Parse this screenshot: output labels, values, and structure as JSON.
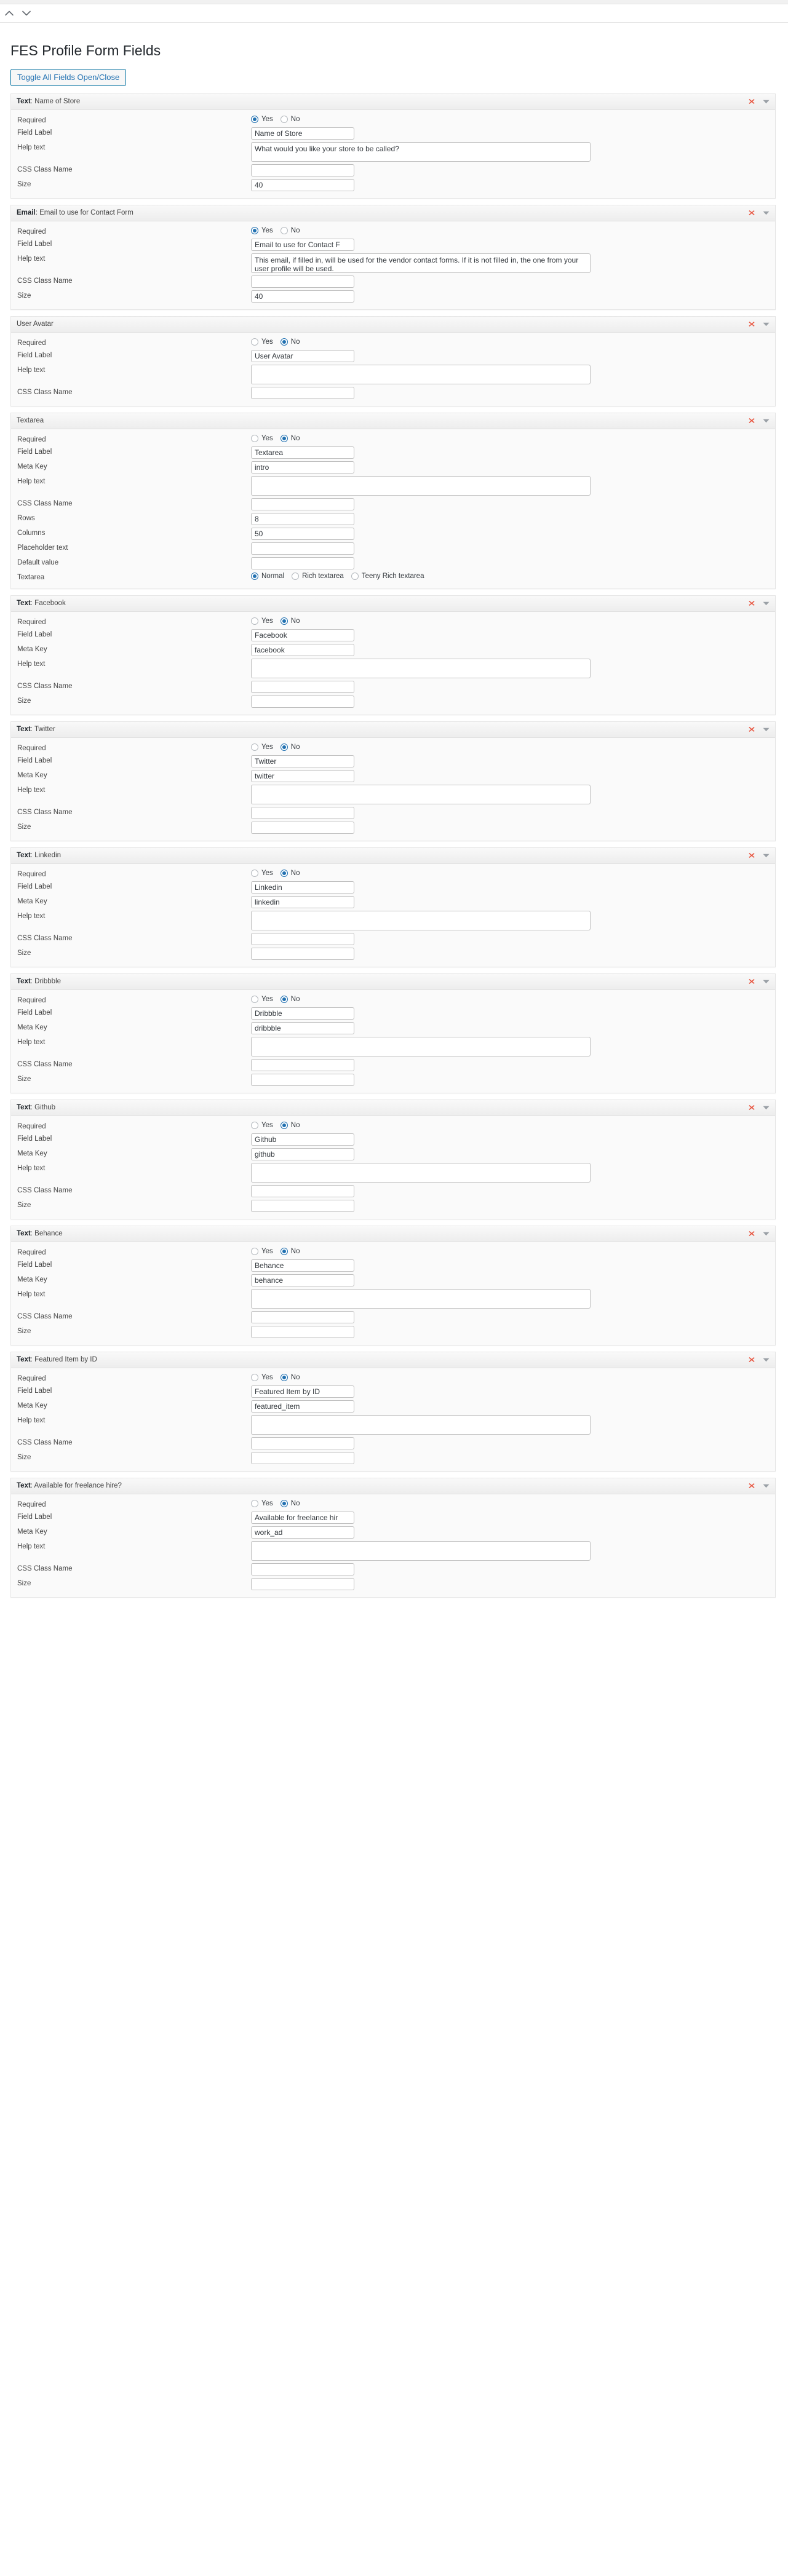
{
  "page": {
    "title": "FES Profile Form Fields",
    "toggle_all_label": "Toggle All Fields Open/Close"
  },
  "screen_meta": {
    "collapse_up_icon": "chevron-up-icon",
    "collapse_down_icon": "chevron-down-icon"
  },
  "panel_icons": {
    "remove": "remove-field-icon",
    "toggle": "toggle-panel-icon"
  },
  "labels": {
    "required": "Required",
    "field_label": "Field Label",
    "meta_key": "Meta Key",
    "help_text": "Help text",
    "css_class_name": "CSS Class Name",
    "size": "Size",
    "rows": "Rows",
    "columns": "Columns",
    "placeholder_text": "Placeholder text",
    "default_value": "Default value",
    "textarea": "Textarea"
  },
  "options": {
    "yes": "Yes",
    "no": "No",
    "normal": "Normal",
    "rich_textarea": "Rich textarea",
    "teeny_rich_textarea": "Teeny Rich textarea"
  },
  "fields": [
    {
      "type_label": "Text",
      "title_text": "Name of Store",
      "required": "yes",
      "field_label": "Name of Store",
      "help_text": "What would you like your store to be called?",
      "css_class": "",
      "size": "40",
      "rows": [
        {
          "kind": "radio-yesno",
          "label_key": "required",
          "selected": "yes"
        },
        {
          "kind": "text",
          "label_key": "field_label",
          "value": "Name of Store"
        },
        {
          "kind": "textarea",
          "label_key": "help_text",
          "value": "What would you like your store to be called?"
        },
        {
          "kind": "text",
          "label_key": "css_class_name",
          "value": ""
        },
        {
          "kind": "text",
          "label_key": "size",
          "value": "40"
        }
      ]
    },
    {
      "type_label": "Email",
      "title_text": "Email to use for Contact Form",
      "rows": [
        {
          "kind": "radio-yesno",
          "label_key": "required",
          "selected": "yes"
        },
        {
          "kind": "text",
          "label_key": "field_label",
          "value": "Email to use for Contact F"
        },
        {
          "kind": "textarea",
          "label_key": "help_text",
          "value": "This email, if filled in, will be used for the vendor contact forms. If it is not filled in, the one from your user profile will be used."
        },
        {
          "kind": "text",
          "label_key": "css_class_name",
          "value": ""
        },
        {
          "kind": "text",
          "label_key": "size",
          "value": "40"
        }
      ]
    },
    {
      "type_label": "",
      "title_text": "User Avatar",
      "rows": [
        {
          "kind": "radio-yesno",
          "label_key": "required",
          "selected": "no"
        },
        {
          "kind": "text",
          "label_key": "field_label",
          "value": "User Avatar"
        },
        {
          "kind": "textarea",
          "label_key": "help_text",
          "value": ""
        },
        {
          "kind": "text",
          "label_key": "css_class_name",
          "value": ""
        }
      ]
    },
    {
      "type_label": "",
      "title_text": "Textarea",
      "rows": [
        {
          "kind": "radio-yesno",
          "label_key": "required",
          "selected": "no"
        },
        {
          "kind": "text",
          "label_key": "field_label",
          "value": "Textarea"
        },
        {
          "kind": "text",
          "label_key": "meta_key",
          "value": "intro"
        },
        {
          "kind": "textarea",
          "label_key": "help_text",
          "value": ""
        },
        {
          "kind": "text",
          "label_key": "css_class_name",
          "value": ""
        },
        {
          "kind": "text",
          "label_key": "rows",
          "value": "8"
        },
        {
          "kind": "text",
          "label_key": "columns",
          "value": "50"
        },
        {
          "kind": "text",
          "label_key": "placeholder_text",
          "value": ""
        },
        {
          "kind": "text",
          "label_key": "default_value",
          "value": ""
        },
        {
          "kind": "radio-textarea",
          "label_key": "textarea",
          "selected": "normal"
        }
      ]
    },
    {
      "type_label": "Text",
      "title_text": "Facebook",
      "rows": [
        {
          "kind": "radio-yesno",
          "label_key": "required",
          "selected": "no"
        },
        {
          "kind": "text",
          "label_key": "field_label",
          "value": "Facebook"
        },
        {
          "kind": "text",
          "label_key": "meta_key",
          "value": "facebook"
        },
        {
          "kind": "textarea",
          "label_key": "help_text",
          "value": ""
        },
        {
          "kind": "text",
          "label_key": "css_class_name",
          "value": ""
        },
        {
          "kind": "text",
          "label_key": "size",
          "value": ""
        }
      ]
    },
    {
      "type_label": "Text",
      "title_text": "Twitter",
      "rows": [
        {
          "kind": "radio-yesno",
          "label_key": "required",
          "selected": "no"
        },
        {
          "kind": "text",
          "label_key": "field_label",
          "value": "Twitter"
        },
        {
          "kind": "text",
          "label_key": "meta_key",
          "value": "twitter"
        },
        {
          "kind": "textarea",
          "label_key": "help_text",
          "value": ""
        },
        {
          "kind": "text",
          "label_key": "css_class_name",
          "value": ""
        },
        {
          "kind": "text",
          "label_key": "size",
          "value": ""
        }
      ]
    },
    {
      "type_label": "Text",
      "title_text": "Linkedin",
      "rows": [
        {
          "kind": "radio-yesno",
          "label_key": "required",
          "selected": "no"
        },
        {
          "kind": "text",
          "label_key": "field_label",
          "value": "Linkedin"
        },
        {
          "kind": "text",
          "label_key": "meta_key",
          "value": "linkedin"
        },
        {
          "kind": "textarea",
          "label_key": "help_text",
          "value": ""
        },
        {
          "kind": "text",
          "label_key": "css_class_name",
          "value": ""
        },
        {
          "kind": "text",
          "label_key": "size",
          "value": ""
        }
      ]
    },
    {
      "type_label": "Text",
      "title_text": "Dribbble",
      "rows": [
        {
          "kind": "radio-yesno",
          "label_key": "required",
          "selected": "no"
        },
        {
          "kind": "text",
          "label_key": "field_label",
          "value": "Dribbble"
        },
        {
          "kind": "text",
          "label_key": "meta_key",
          "value": "dribbble"
        },
        {
          "kind": "textarea",
          "label_key": "help_text",
          "value": ""
        },
        {
          "kind": "text",
          "label_key": "css_class_name",
          "value": ""
        },
        {
          "kind": "text",
          "label_key": "size",
          "value": ""
        }
      ]
    },
    {
      "type_label": "Text",
      "title_text": "Github",
      "rows": [
        {
          "kind": "radio-yesno",
          "label_key": "required",
          "selected": "no"
        },
        {
          "kind": "text",
          "label_key": "field_label",
          "value": "Github"
        },
        {
          "kind": "text",
          "label_key": "meta_key",
          "value": "github"
        },
        {
          "kind": "textarea",
          "label_key": "help_text",
          "value": ""
        },
        {
          "kind": "text",
          "label_key": "css_class_name",
          "value": ""
        },
        {
          "kind": "text",
          "label_key": "size",
          "value": ""
        }
      ]
    },
    {
      "type_label": "Text",
      "title_text": "Behance",
      "rows": [
        {
          "kind": "radio-yesno",
          "label_key": "required",
          "selected": "no"
        },
        {
          "kind": "text",
          "label_key": "field_label",
          "value": "Behance"
        },
        {
          "kind": "text",
          "label_key": "meta_key",
          "value": "behance"
        },
        {
          "kind": "textarea",
          "label_key": "help_text",
          "value": ""
        },
        {
          "kind": "text",
          "label_key": "css_class_name",
          "value": ""
        },
        {
          "kind": "text",
          "label_key": "size",
          "value": ""
        }
      ]
    },
    {
      "type_label": "Text",
      "title_text": "Featured Item by ID",
      "rows": [
        {
          "kind": "radio-yesno",
          "label_key": "required",
          "selected": "no"
        },
        {
          "kind": "text",
          "label_key": "field_label",
          "value": "Featured Item by ID"
        },
        {
          "kind": "text",
          "label_key": "meta_key",
          "value": "featured_item"
        },
        {
          "kind": "textarea",
          "label_key": "help_text",
          "value": ""
        },
        {
          "kind": "text",
          "label_key": "css_class_name",
          "value": ""
        },
        {
          "kind": "text",
          "label_key": "size",
          "value": ""
        }
      ]
    },
    {
      "type_label": "Text",
      "title_text": "Available for freelance hire?",
      "rows": [
        {
          "kind": "radio-yesno",
          "label_key": "required",
          "selected": "no"
        },
        {
          "kind": "text",
          "label_key": "field_label",
          "value": "Available for freelance hir"
        },
        {
          "kind": "text",
          "label_key": "meta_key",
          "value": "work_ad"
        },
        {
          "kind": "textarea",
          "label_key": "help_text",
          "value": ""
        },
        {
          "kind": "text",
          "label_key": "css_class_name",
          "value": ""
        },
        {
          "kind": "text",
          "label_key": "size",
          "value": ""
        }
      ]
    }
  ]
}
